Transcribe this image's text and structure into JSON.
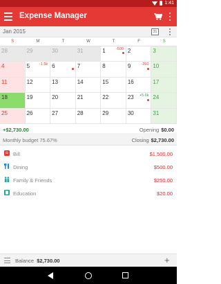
{
  "status_bar": {
    "time": "1:41"
  },
  "app_bar": {
    "title": "Expense Manager"
  },
  "month_bar": {
    "month": "Jan 2015",
    "cal_icon_text": "31"
  },
  "weekdays": [
    "S",
    "M",
    "T",
    "W",
    "T",
    "F",
    "S"
  ],
  "calendar": {
    "weeks": [
      [
        {
          "day": "28",
          "type": "dim"
        },
        {
          "day": "29",
          "type": "dim"
        },
        {
          "day": "30",
          "type": "dim"
        },
        {
          "day": "31",
          "type": "dim"
        },
        {
          "day": "1",
          "amount": "-500",
          "dot": true
        },
        {
          "day": "2"
        },
        {
          "day": "3",
          "type": "sat"
        }
      ],
      [
        {
          "day": "4",
          "type": "sun"
        },
        {
          "day": "5",
          "amount": "-1.5k"
        },
        {
          "day": "6",
          "dot": true
        },
        {
          "day": "7"
        },
        {
          "day": "8"
        },
        {
          "day": "9",
          "amount": "-250",
          "dot": true
        },
        {
          "day": "10",
          "type": "sat"
        }
      ],
      [
        {
          "day": "11",
          "type": "sun"
        },
        {
          "day": "12"
        },
        {
          "day": "13"
        },
        {
          "day": "14"
        },
        {
          "day": "15"
        },
        {
          "day": "16"
        },
        {
          "day": "17",
          "type": "sat"
        }
      ],
      [
        {
          "day": "18",
          "type": "today"
        },
        {
          "day": "19"
        },
        {
          "day": "20"
        },
        {
          "day": "21"
        },
        {
          "day": "22"
        },
        {
          "day": "23",
          "amount": "+5.6k",
          "positive": true,
          "dot": true
        },
        {
          "day": "24",
          "type": "sat"
        }
      ],
      [
        {
          "day": "25",
          "type": "sun"
        },
        {
          "day": "26"
        },
        {
          "day": "27"
        },
        {
          "day": "28"
        },
        {
          "day": "29"
        },
        {
          "day": "30"
        },
        {
          "day": "31",
          "type": "sat"
        }
      ]
    ]
  },
  "summary": {
    "income": "+$2,730.00",
    "opening_label": "Opening",
    "opening_value": "$0.00",
    "budget_label": "Monthly budget",
    "budget_percent": "75.67%",
    "closing_label": "Closing",
    "closing_value": "$2,730.00"
  },
  "categories": [
    {
      "name": "Bill",
      "value": "$1,500.00",
      "icon": "bill-icon",
      "color": "#e53935"
    },
    {
      "name": "Dining",
      "value": "$500.00",
      "icon": "dining-icon",
      "color": "#1e88e5"
    },
    {
      "name": "Family & Friends",
      "value": "$250.00",
      "icon": "family-icon",
      "color": "#26a69a"
    },
    {
      "name": "Education",
      "value": "$20.00",
      "icon": "education-icon",
      "color": "#26a69a"
    }
  ],
  "bottom": {
    "balance_label": "Balance",
    "balance_value": "$2,730.00"
  },
  "colors": {
    "accent": "#e53935",
    "status_bar": "#b71c1c",
    "positive": "#2e7d32",
    "negative": "#d32f2f"
  }
}
